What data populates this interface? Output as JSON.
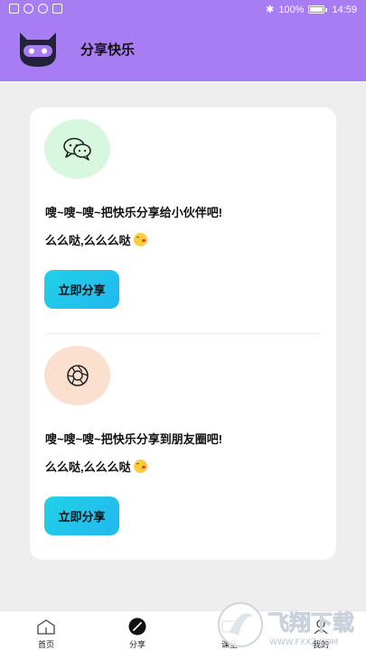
{
  "status_bar": {
    "battery_percent": "100%",
    "time": "14:59"
  },
  "header": {
    "title": "分享快乐",
    "logo_icon": "robot-cat-logo-icon",
    "bg_color": "#a87cf3"
  },
  "share_sections": [
    {
      "icon": "wechat-chat-icon",
      "line1": "嗖~嗖~嗖~把快乐分享给小伙伴吧!",
      "line2": "么么哒,么么么哒",
      "emoji": "kissing-face-emoji",
      "button_label": "立即分享"
    },
    {
      "icon": "moments-shutter-icon",
      "line1": "嗖~嗖~嗖~把快乐分享到朋友圈吧!",
      "line2": "么么哒,么么么哒",
      "emoji": "kissing-face-emoji",
      "button_label": "立即分享"
    }
  ],
  "tabbar": {
    "items": [
      {
        "label": "首页",
        "icon": "home-icon"
      },
      {
        "label": "分享",
        "icon": "pen-icon",
        "active": true
      },
      {
        "label": "课堂",
        "icon": "classroom-icon"
      },
      {
        "label": "我的",
        "icon": "profile-icon"
      }
    ]
  },
  "watermark": {
    "text": "飞翔下载",
    "url_text": "WWW.FXXZ.COM"
  },
  "colors": {
    "accent_button": "#21d1e6",
    "card_bg": "#ffffff",
    "page_bg": "#eeeeee"
  }
}
